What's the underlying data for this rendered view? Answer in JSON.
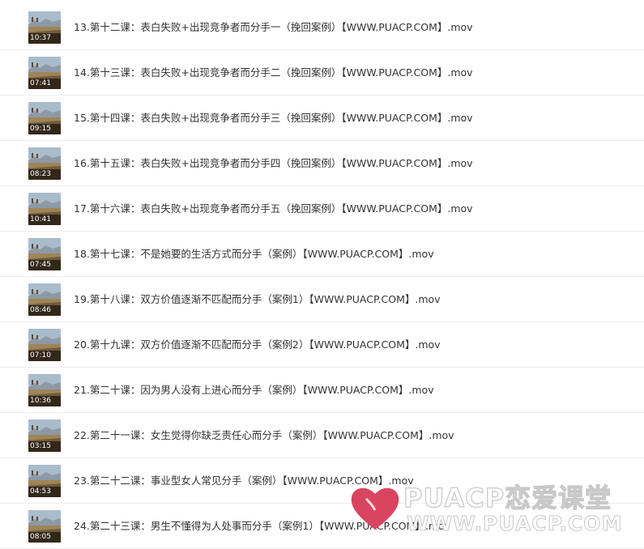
{
  "files": [
    {
      "duration": "10:37",
      "name": "13.第十二课：表白失败+出现竞争者而分手一（挽回案例）【WWW.PUACP.COM】.mov"
    },
    {
      "duration": "07:41",
      "name": "14.第十三课：表白失败+出现竞争者而分手二（挽回案例）【WWW.PUACP.COM】.mov"
    },
    {
      "duration": "09:15",
      "name": "15.第十四课：表白失败+出现竞争者而分手三（挽回案例）【WWW.PUACP.COM】.mov"
    },
    {
      "duration": "08:23",
      "name": "16.第十五课：表白失败+出现竞争者而分手四（挽回案例）【WWW.PUACP.COM】.mov"
    },
    {
      "duration": "10:41",
      "name": "17.第十六课：表白失败+出现竞争者而分手五（挽回案例）【WWW.PUACP.COM】.mov"
    },
    {
      "duration": "07:45",
      "name": "18.第十七课：不是她要的生活方式而分手（案例）【WWW.PUACP.COM】.mov"
    },
    {
      "duration": "08:46",
      "name": "19.第十八课：双方价值逐渐不匹配而分手（案例1）【WWW.PUACP.COM】.mov"
    },
    {
      "duration": "07:10",
      "name": "20.第十九课：双方价值逐渐不匹配而分手（案例2）【WWW.PUACP.COM】.mov"
    },
    {
      "duration": "10:36",
      "name": "21.第二十课：因为男人没有上进心而分手（案例）【WWW.PUACP.COM】.mov"
    },
    {
      "duration": "03:15",
      "name": "22.第二十一课：女生觉得你缺乏责任心而分手（案例）【WWW.PUACP.COM】.mov"
    },
    {
      "duration": "04:53",
      "name": "23.第二十二课：事业型女人常见分手（案例）【WWW.PUACP.COM】.mov"
    },
    {
      "duration": "08:05",
      "name": "24.第二十三课：男生不懂得为人处事而分手（案例1）【WWW.PUACP.COM】.mov"
    }
  ],
  "watermark": {
    "title": "PUACP恋爱课堂",
    "url": "WWW.PUACP.COM",
    "heart_color": "#d9455f"
  }
}
